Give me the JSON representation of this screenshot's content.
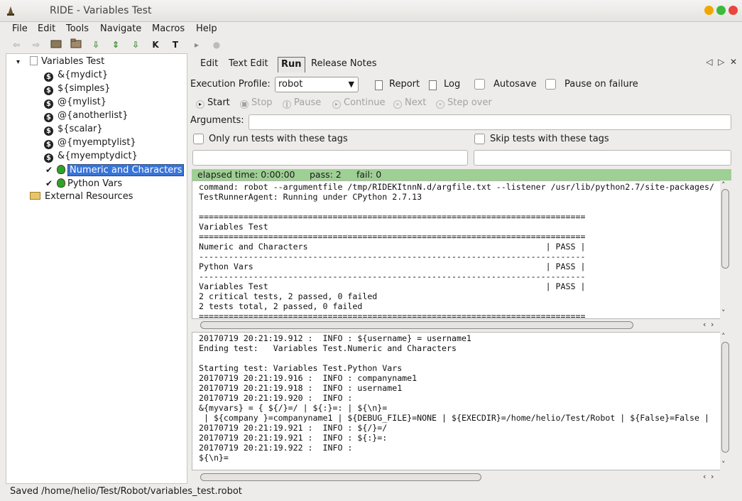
{
  "window": {
    "title": "RIDE - Variables Test"
  },
  "menu": [
    "File",
    "Edit",
    "Tools",
    "Navigate",
    "Macros",
    "Help"
  ],
  "tree": {
    "root": "Variables Test",
    "vars": [
      "&{mydict}",
      "${simples}",
      "@{mylist}",
      "@{anotherlist}",
      "${scalar}",
      "@{myemptylist}",
      "&{myemptydict}"
    ],
    "tests": [
      "Numeric and Characters",
      "Python Vars"
    ],
    "external": "External Resources"
  },
  "tabs": [
    "Edit",
    "Text Edit",
    "Run",
    "Release Notes"
  ],
  "run": {
    "profile_label": "Execution Profile:",
    "profile_value": "robot",
    "report": "Report",
    "log": "Log",
    "autosave": "Autosave",
    "pause_on_failure": "Pause on failure",
    "buttons": [
      "Start",
      "Stop",
      "Pause",
      "Continue",
      "Next",
      "Step over"
    ],
    "arguments_label": "Arguments:",
    "only_run_tags": "Only run tests with these tags",
    "skip_tags": "Skip tests with these tags",
    "elapsed": "elapsed time: 0:00:00",
    "pass": "pass: 2",
    "fail": "fail: 0"
  },
  "console_top": "command: robot --argumentfile /tmp/RIDEKItnnN.d/argfile.txt --listener /usr/lib/python2.7/site-packages/\nTestRunnerAgent: Running under CPython 2.7.13\n\n==============================================================================\nVariables Test\n==============================================================================\nNumeric and Characters                                                | PASS |\n------------------------------------------------------------------------------\nPython Vars                                                           | PASS |\n------------------------------------------------------------------------------\nVariables Test                                                        | PASS |\n2 critical tests, 2 passed, 0 failed\n2 tests total, 2 passed, 0 failed\n==============================================================================",
  "console_bottom": "20170719 20:21:19.912 :  INFO : ${username} = username1\nEnding test:   Variables Test.Numeric and Characters\n\nStarting test: Variables Test.Python Vars\n20170719 20:21:19.916 :  INFO : companyname1\n20170719 20:21:19.918 :  INFO : username1\n20170719 20:21:19.920 :  INFO :\n&{myvars} = { ${/}=/ | ${:}=: | ${\\n}=\n | ${company }=companyname1 | ${DEBUG_FILE}=NONE | ${EXECDIR}=/home/helio/Test/Robot | ${False}=False |\n20170719 20:21:19.921 :  INFO : ${/}=/\n20170719 20:21:19.921 :  INFO : ${:}=:\n20170719 20:21:19.922 :  INFO :\n${\\n}=",
  "status": "Saved /home/helio/Test/Robot/variables_test.robot",
  "colors": {
    "selection": "#3874d8",
    "pass_bar": "#9ecf94",
    "close": "#e8453c",
    "minimize": "#f0a800",
    "maximize": "#3cba3c"
  }
}
